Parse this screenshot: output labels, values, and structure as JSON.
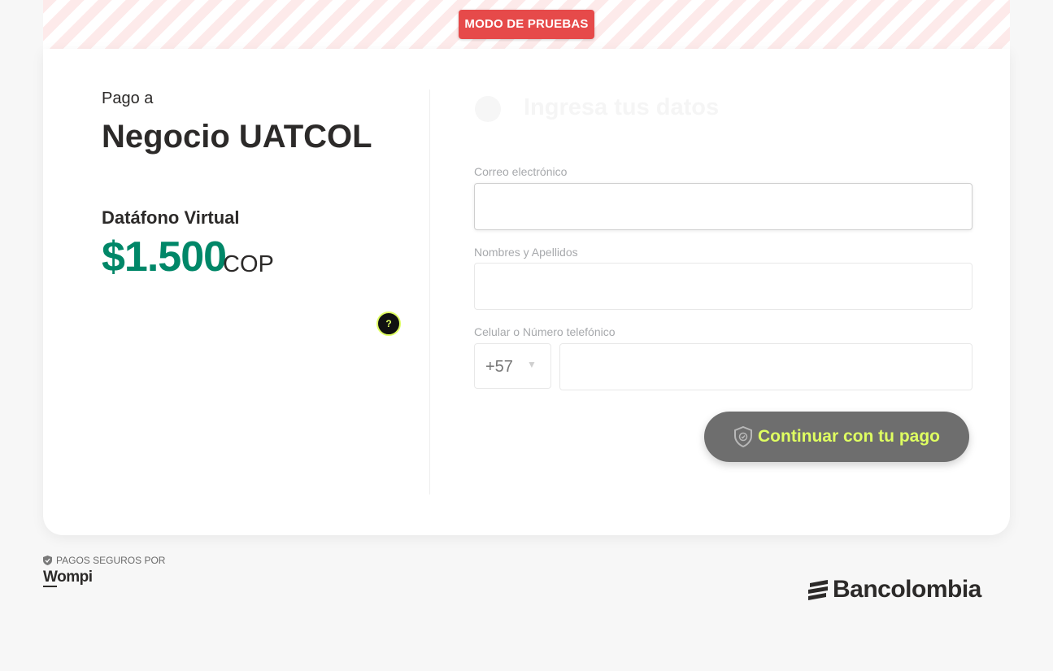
{
  "banner": {
    "test_mode_label": "MODO DE PRUEBAS"
  },
  "summary": {
    "pay_to_label": "Pago a",
    "merchant_name": "Negocio UATCOL",
    "product_name": "Datáfono Virtual",
    "amount": "$1.500",
    "currency": "COP",
    "help_label": "?"
  },
  "form": {
    "step_title": "Ingresa tus datos",
    "email_label": "Correo electrónico",
    "email_value": "",
    "name_label": "Nombres y Apellidos",
    "name_value": "",
    "phone_label": "Celular o Número telefónico",
    "phone_prefix": "+57",
    "phone_value": "",
    "continue_label": "Continuar con tu pago"
  },
  "footer": {
    "secure_label": "PAGOS SEGUROS POR",
    "provider": "Wompi",
    "bank": "Bancolombia"
  },
  "colors": {
    "accent_green": "#008768",
    "badge_red": "#e64a4a",
    "button_text": "#dfff61",
    "button_bg": "#6e6e6e"
  },
  "icons": [
    "help-icon",
    "shield-check-icon",
    "shield-small-icon",
    "chevron-down-icon",
    "bancolombia-logo-icon"
  ]
}
